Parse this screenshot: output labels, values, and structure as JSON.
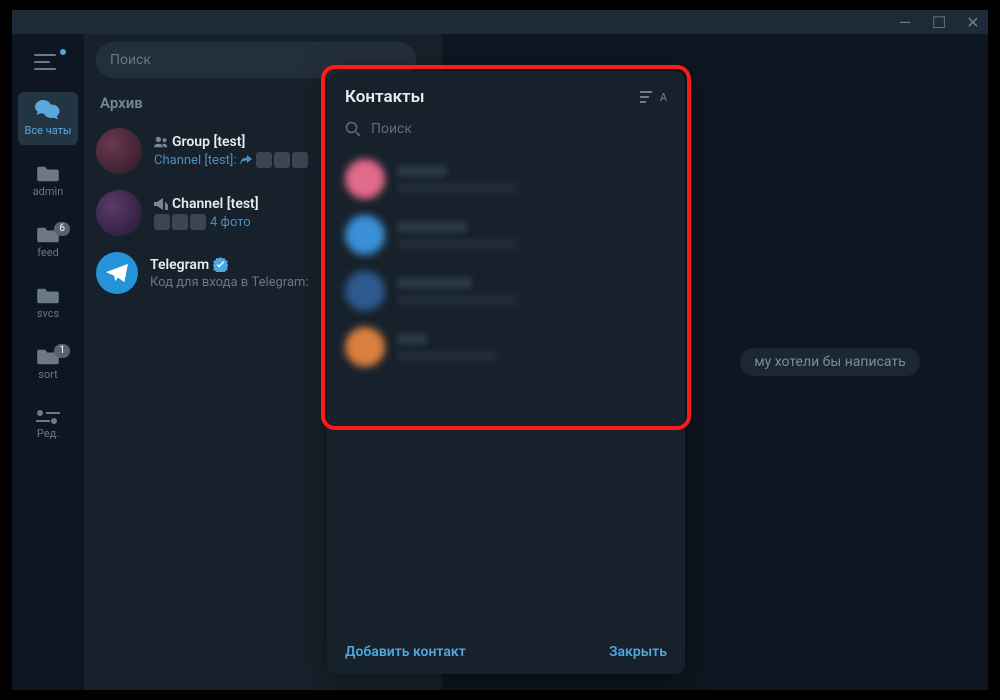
{
  "titlebar": {
    "min": "—",
    "max": "☐",
    "close": "✕"
  },
  "sidebar": {
    "folders": [
      {
        "label": "Все чаты",
        "active": true,
        "icon": "chats"
      },
      {
        "label": "admin",
        "icon": "folder"
      },
      {
        "label": "feed",
        "icon": "folder",
        "badge": "6"
      },
      {
        "label": "svcs",
        "icon": "folder"
      },
      {
        "label": "sort",
        "icon": "folder",
        "badge": "1"
      },
      {
        "label": "Ред.",
        "icon": "edit"
      }
    ]
  },
  "search": {
    "placeholder": "Поиск"
  },
  "archive_label": "Архив",
  "chats": [
    {
      "name": "Group [test]",
      "icon_type": "group",
      "preview_prefix": "Channel [test]:",
      "preview_kind": "forward_thumbs",
      "avatar_color1": "#3a2331",
      "avatar_color2": "#6b3a4f"
    },
    {
      "name": "Channel [test]",
      "icon_type": "channel",
      "preview_text": "4 фото",
      "preview_kind": "thumbs",
      "avatar_color1": "#2b1d38",
      "avatar_color2": "#5a3a6b"
    },
    {
      "name": "Telegram",
      "icon_type": "verified",
      "preview_text": "Код для входа в Telegram:",
      "preview_kind": "gray",
      "avatar_color1": "#2693d8",
      "avatar_color2": "#2693d8"
    }
  ],
  "main": {
    "placeholder": "му хотели бы написать"
  },
  "dialog": {
    "title": "Контакты",
    "search_placeholder": "Поиск",
    "contacts": [
      {
        "color": "#e26a8a",
        "name_w": 50,
        "status_w": 120
      },
      {
        "color": "#3a8fd6",
        "name_w": 70,
        "status_w": 120
      },
      {
        "color": "#2d5a8f",
        "name_w": 75,
        "status_w": 120
      },
      {
        "color": "#d9803d",
        "name_w": 30,
        "status_w": 100
      }
    ],
    "add_label": "Добавить контакт",
    "close_label": "Закрыть"
  }
}
